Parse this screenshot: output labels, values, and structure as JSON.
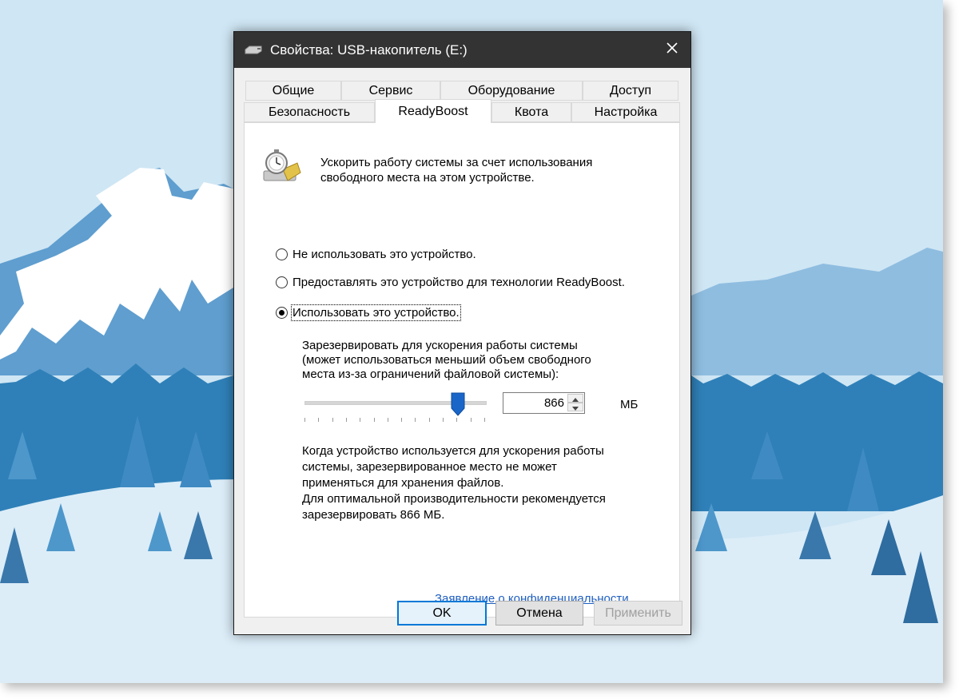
{
  "window": {
    "title": "Свойства: USB-накопитель (E:)",
    "icon": "usb-drive-icon",
    "close_icon": "close-icon"
  },
  "tabs": {
    "row1": [
      "Общие",
      "Сервис",
      "Оборудование",
      "Доступ"
    ],
    "row2": [
      "Безопасность",
      "ReadyBoost",
      "Квота",
      "Настройка"
    ],
    "active": "ReadyBoost"
  },
  "readyboost": {
    "icon": "readyboost-stopwatch-icon",
    "description": [
      "Ускорить работу системы за счет использования",
      "свободного места на этом устройстве."
    ],
    "options": [
      {
        "label": "Не использовать это устройство.",
        "checked": false
      },
      {
        "label": "Предоставлять это устройство для технологии ReadyBoost.",
        "checked": false
      },
      {
        "label": "Использовать это устройство.",
        "checked": true
      }
    ],
    "reserve_text": [
      "Зарезервировать для ускорения работы системы",
      "(может использоваться меньший объем свободного",
      "места из-за ограничений файловой системы):"
    ],
    "slider_level": 0.85,
    "reserve_value": "866",
    "unit": "МБ",
    "note": [
      "Когда устройство используется для ускорения работы",
      "системы, зарезервированное место не может",
      "применяться для хранения файлов.",
      "Для оптимальной производительности рекомендуется",
      "зарезервировать 866 МБ."
    ],
    "privacy_link": "Заявление о конфиденциальности"
  },
  "buttons": {
    "ok": "OK",
    "cancel": "Отмена",
    "apply": "Применить"
  },
  "colors": {
    "titlebar": "#333333",
    "link": "#1f5fbf",
    "focus": "#0078d7",
    "slider_thumb": "#1a66c8"
  }
}
